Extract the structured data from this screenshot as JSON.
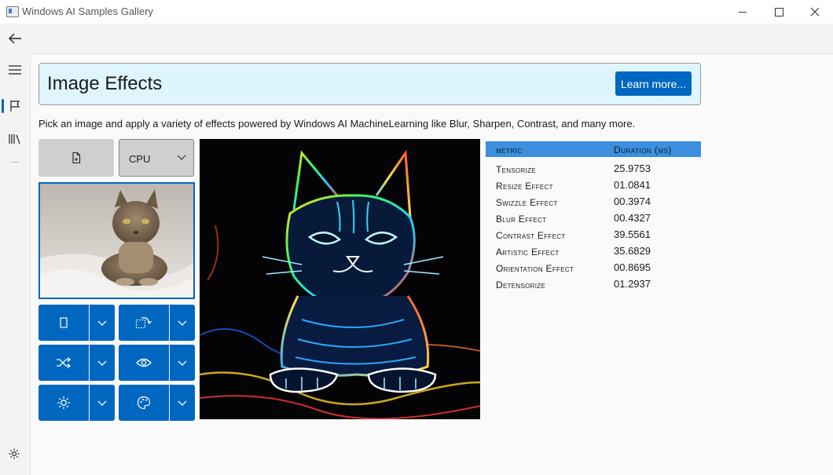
{
  "window": {
    "title": "Windows AI Samples Gallery"
  },
  "header": {
    "title": "Image Effects",
    "learn_more": "Learn more..."
  },
  "description": "Pick an image and apply a variety of effects powered by Windows AI MachineLearning like Blur, Sharpen, Contrast, and many more.",
  "device": {
    "selected": "CPU"
  },
  "metrics": {
    "col_metric": "Metric",
    "col_duration": "Duration (ms)",
    "rows": [
      {
        "name": "Tensorize",
        "value": "25.9753"
      },
      {
        "name": "Resize Effect",
        "value": "01.0841"
      },
      {
        "name": "Swizzle Effect",
        "value": "00.3974"
      },
      {
        "name": "Blur Effect",
        "value": "00.4327"
      },
      {
        "name": "Contrast Effect",
        "value": "39.5561"
      },
      {
        "name": "Artistic Effect",
        "value": "35.6829"
      },
      {
        "name": "Orientation Effect",
        "value": "00.8695"
      },
      {
        "name": "Detensorize",
        "value": "01.2937"
      }
    ]
  },
  "colors": {
    "accent": "#0067c0",
    "header_bg": "#dff5fd",
    "table_header": "#3b8fdc"
  },
  "icons": {
    "back": "back-arrow-icon",
    "menu": "hamburger-menu-icon",
    "samples": "flag-icon",
    "library": "library-icon",
    "settings": "gear-icon",
    "file": "open-file-icon",
    "crop": "crop-icon",
    "orientation": "rotate-icon",
    "shuffle": "shuffle-icon",
    "eye": "eye-icon",
    "brightness": "brightness-icon",
    "palette": "palette-icon"
  }
}
